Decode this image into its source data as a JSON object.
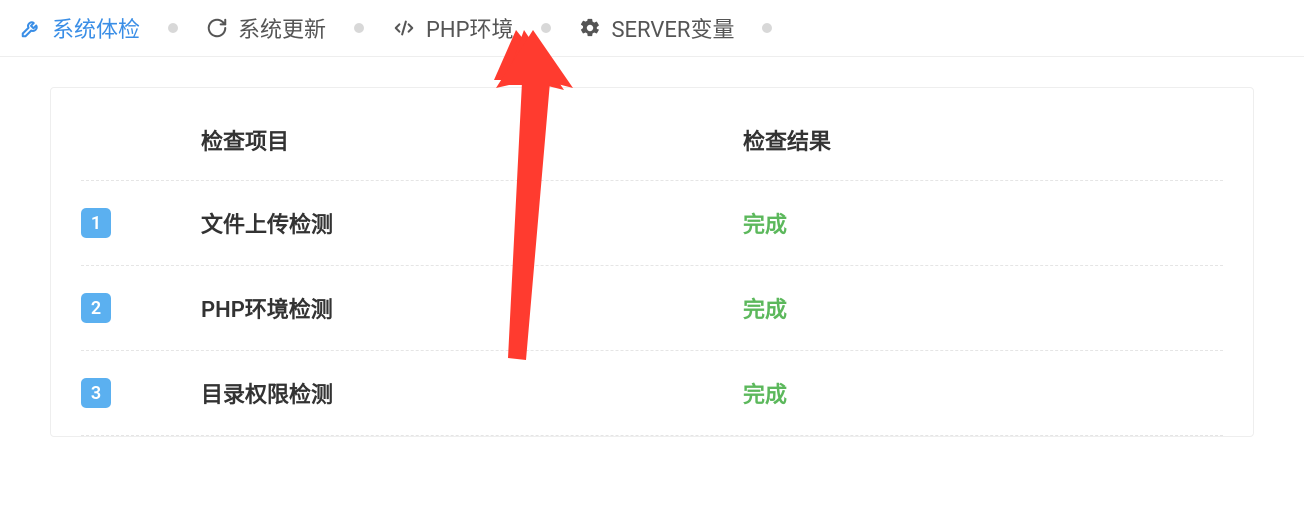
{
  "tabs": [
    {
      "label": "系统体检",
      "icon": "wrench-icon",
      "active": true
    },
    {
      "label": "系统更新",
      "icon": "refresh-icon",
      "active": false
    },
    {
      "label": "PHP环境",
      "icon": "code-icon",
      "active": false
    },
    {
      "label": "SERVER变量",
      "icon": "gear-icon",
      "active": false
    }
  ],
  "table": {
    "header_name": "检查项目",
    "header_result": "检查结果",
    "rows": [
      {
        "idx": "1",
        "name": "文件上传检测",
        "result": "完成"
      },
      {
        "idx": "2",
        "name": "PHP环境检测",
        "result": "完成"
      },
      {
        "idx": "3",
        "name": "目录权限检测",
        "result": "完成"
      }
    ]
  },
  "colors": {
    "active_tab": "#3a8ee6",
    "badge": "#5bb0f0",
    "success": "#5cb85c"
  }
}
